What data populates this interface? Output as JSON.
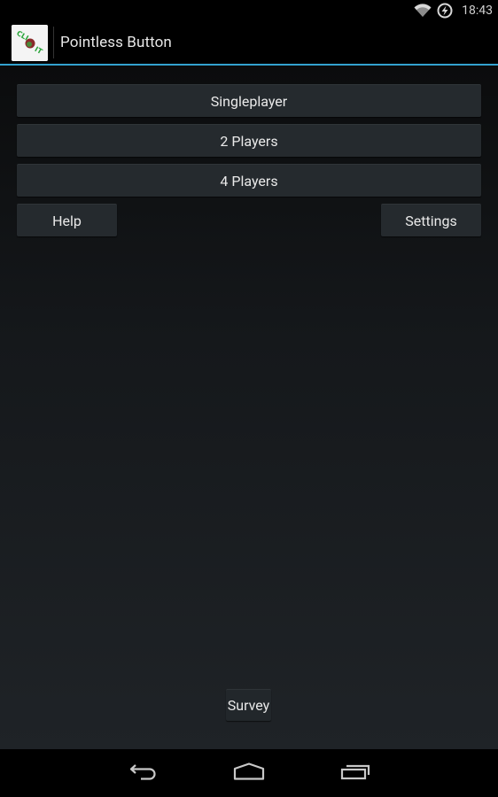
{
  "status_bar": {
    "time": "18:43",
    "icons": [
      "wifi-icon",
      "battery-charging-icon"
    ]
  },
  "action_bar": {
    "title": "Pointless Button",
    "app_icon": "click-it-app-icon",
    "app_icon_text": "CLICK IT",
    "accent_color": "#33a2cf"
  },
  "main": {
    "buttons": {
      "singleplayer": "Singleplayer",
      "two_players": "2 Players",
      "four_players": "4 Players",
      "help": "Help",
      "settings": "Settings",
      "survey": "Survey"
    }
  },
  "nav_bar": {
    "back": "back-icon",
    "home": "home-icon",
    "recents": "recent-apps-icon"
  }
}
